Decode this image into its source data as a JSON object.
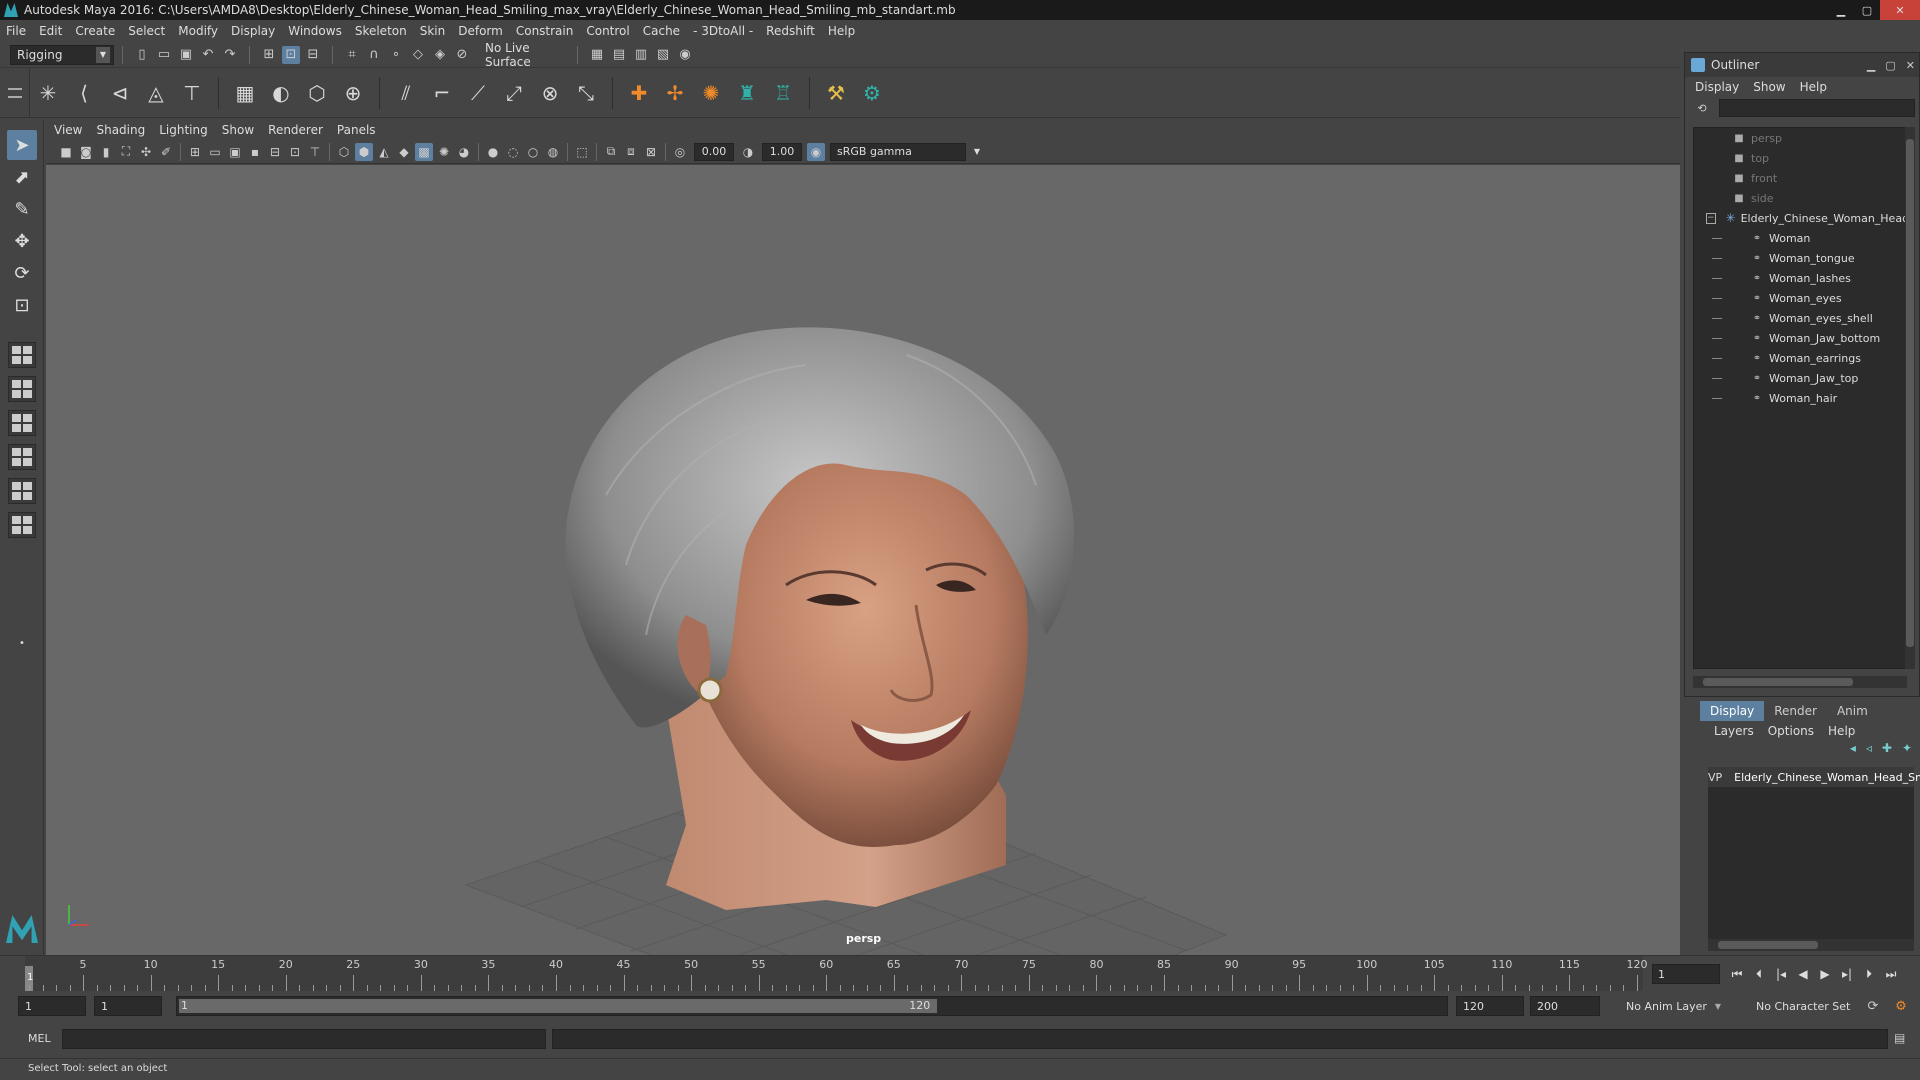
{
  "window": {
    "title": "Autodesk Maya 2016: C:\\Users\\AMDA8\\Desktop\\Elderly_Chinese_Woman_Head_Smiling_max_vray\\Elderly_Chinese_Woman_Head_Smiling_mb_standart.mb",
    "min": "▁",
    "max": "▢",
    "close": "✕"
  },
  "menubar": [
    "File",
    "Edit",
    "Create",
    "Select",
    "Modify",
    "Display",
    "Windows",
    "Skeleton",
    "Skin",
    "Deform",
    "Constrain",
    "Control",
    "Cache",
    "- 3DtoAll -",
    "Redshift",
    "Help"
  ],
  "statusline": {
    "menuset": "Rigging",
    "live_surface": "No Live Surface"
  },
  "viewport": {
    "menu": [
      "View",
      "Shading",
      "Lighting",
      "Show",
      "Renderer",
      "Panels"
    ],
    "exposure": "0.00",
    "gamma": "1.00",
    "colorspace": "sRGB gamma",
    "camera": "persp"
  },
  "outliner": {
    "title": "Outliner",
    "menu": [
      "Display",
      "Show",
      "Help"
    ],
    "items": [
      {
        "label": "persp",
        "type": "camera",
        "dim": true
      },
      {
        "label": "top",
        "type": "camera",
        "dim": true
      },
      {
        "label": "front",
        "type": "camera",
        "dim": true
      },
      {
        "label": "side",
        "type": "camera",
        "dim": true
      },
      {
        "label": "Elderly_Chinese_Woman_Head_Smiling",
        "type": "group",
        "dim": false
      },
      {
        "label": "Woman",
        "type": "mesh",
        "dim": false
      },
      {
        "label": "Woman_tongue",
        "type": "mesh",
        "dim": false
      },
      {
        "label": "Woman_lashes",
        "type": "mesh",
        "dim": false
      },
      {
        "label": "Woman_eyes",
        "type": "mesh",
        "dim": false
      },
      {
        "label": "Woman_eyes_shell",
        "type": "mesh",
        "dim": false
      },
      {
        "label": "Woman_Jaw_bottom",
        "type": "mesh",
        "dim": false
      },
      {
        "label": "Woman_earrings",
        "type": "mesh",
        "dim": false
      },
      {
        "label": "Woman_Jaw_top",
        "type": "mesh",
        "dim": false
      },
      {
        "label": "Woman_hair",
        "type": "mesh",
        "dim": false
      }
    ]
  },
  "layers": {
    "tabs": [
      "Display",
      "Render",
      "Anim"
    ],
    "active_tab": "Display",
    "menu": [
      "Layers",
      "Options",
      "Help"
    ],
    "rows": [
      {
        "v": "V",
        "p": "P",
        "name": "Elderly_Chinese_Woman_Head_Smiling",
        "color": "#b01c3a"
      }
    ]
  },
  "timeline": {
    "ticks": [
      5,
      10,
      15,
      20,
      25,
      30,
      35,
      40,
      45,
      50,
      55,
      60,
      65,
      70,
      75,
      80,
      85,
      90,
      95,
      100,
      105,
      110,
      115,
      120
    ],
    "range_min": 1,
    "range_max": 120,
    "current_frame": "1",
    "frame_field": "1"
  },
  "range": {
    "start": "1",
    "playback_start": "1",
    "bar_start": "1",
    "bar_end": "120",
    "playback_end": "120",
    "end": "200",
    "anim_layer": "No Anim Layer",
    "character_set": "No Character Set"
  },
  "cmdline": {
    "label": "MEL"
  },
  "helpline": {
    "text": "Select Tool: select an object"
  }
}
